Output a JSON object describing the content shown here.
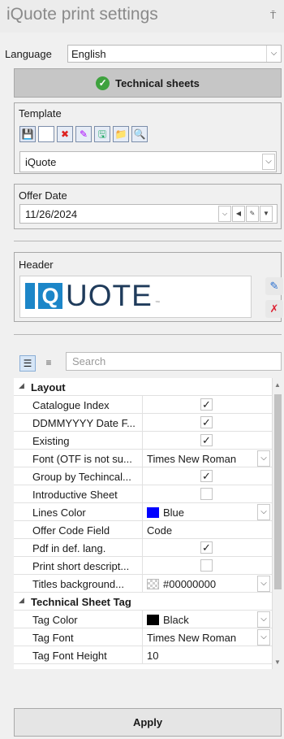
{
  "window": {
    "title": "iQuote print settings",
    "pin_glyph": "⍑"
  },
  "language": {
    "label": "Language",
    "value": "English"
  },
  "technical_sheets": {
    "label": "Technical sheets"
  },
  "template": {
    "group_label": "Template",
    "toolbar_icons": [
      "save-icon",
      "new-icon",
      "delete-icon",
      "rename-icon",
      "save-as-icon",
      "export-icon",
      "import-icon"
    ],
    "value": "iQuote"
  },
  "offer_date": {
    "group_label": "Offer Date",
    "value": "11/26/2024"
  },
  "header": {
    "group_label": "Header",
    "logo_text": "UOTE",
    "logo_q": "Q",
    "logo_tm": "™"
  },
  "search": {
    "placeholder": "Search"
  },
  "grid": {
    "categories": [
      {
        "name": "Layout"
      },
      {
        "name": "Technical Sheet Tag"
      }
    ],
    "layout_rows": [
      {
        "name": "Catalogue Index",
        "type": "check",
        "checked": true
      },
      {
        "name": "DDMMYYYY Date F...",
        "type": "check",
        "checked": true
      },
      {
        "name": "Existing",
        "type": "check",
        "checked": true
      },
      {
        "name": "Font (OTF is not su...",
        "type": "select",
        "value": "Times New Roman"
      },
      {
        "name": "Group by Techincal...",
        "type": "check",
        "checked": true
      },
      {
        "name": "Introductive Sheet",
        "type": "check",
        "checked": false
      },
      {
        "name": "Lines Color",
        "type": "color",
        "value": "Blue",
        "color": "#0000ff"
      },
      {
        "name": "Offer Code Field",
        "type": "text",
        "value": "Code"
      },
      {
        "name": "Pdf in def. lang.",
        "type": "check",
        "checked": true
      },
      {
        "name": "Print short descript...",
        "type": "check",
        "checked": false
      },
      {
        "name": "Titles background...",
        "type": "color",
        "value": "#00000000",
        "color": "transparent"
      }
    ],
    "tag_rows": [
      {
        "name": "Tag Color",
        "type": "color",
        "value": "Black",
        "color": "#000000"
      },
      {
        "name": "Tag Font",
        "type": "select",
        "value": "Times New Roman"
      },
      {
        "name": "Tag Font Height",
        "type": "text",
        "value": "10"
      }
    ]
  },
  "apply": {
    "label": "Apply"
  }
}
